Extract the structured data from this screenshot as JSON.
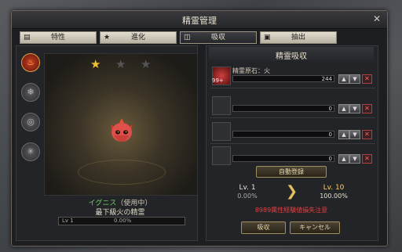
{
  "window": {
    "title": "精霊管理",
    "close_glyph": "✕"
  },
  "tabs": [
    {
      "label": "特性",
      "icon": "trait-icon"
    },
    {
      "label": "進化",
      "icon": "star-icon"
    },
    {
      "label": "吸収",
      "icon": "absorb-icon"
    },
    {
      "label": "抽出",
      "icon": "extract-icon"
    }
  ],
  "active_tab": 2,
  "side_icons": [
    "fire-element-icon",
    "ice-element-icon",
    "wind-element-icon",
    "lightning-element-icon"
  ],
  "stars": {
    "filled": 1,
    "total": 3
  },
  "spirit": {
    "name": "イグニス",
    "status": "（使用中）",
    "subtitle": "最下級火の精霊",
    "level_label": "Lv 1",
    "exp_text": "0.00%",
    "exp_fraction": 0.0
  },
  "absorb": {
    "title": "精霊吸収",
    "slots": [
      {
        "name": "精霊原石：火",
        "count": "99+",
        "value": "244",
        "filled": true
      },
      {
        "name": "",
        "count": "",
        "value": "0",
        "filled": false
      },
      {
        "name": "",
        "count": "",
        "value": "0",
        "filled": false
      },
      {
        "name": "",
        "count": "",
        "value": "0",
        "filled": false
      }
    ],
    "auto_button": "自動登録",
    "from_level": "Lv. 1",
    "from_pct": "0.00%",
    "to_level": "Lv. 10",
    "to_pct": "100.00%",
    "warning": "8989属性経験値損失注意"
  },
  "buttons": {
    "absorb": "吸収",
    "cancel": "キャンセル"
  },
  "colors": {
    "accent": "#e2c060",
    "warning": "#e04040",
    "name_green": "#6fd060"
  }
}
